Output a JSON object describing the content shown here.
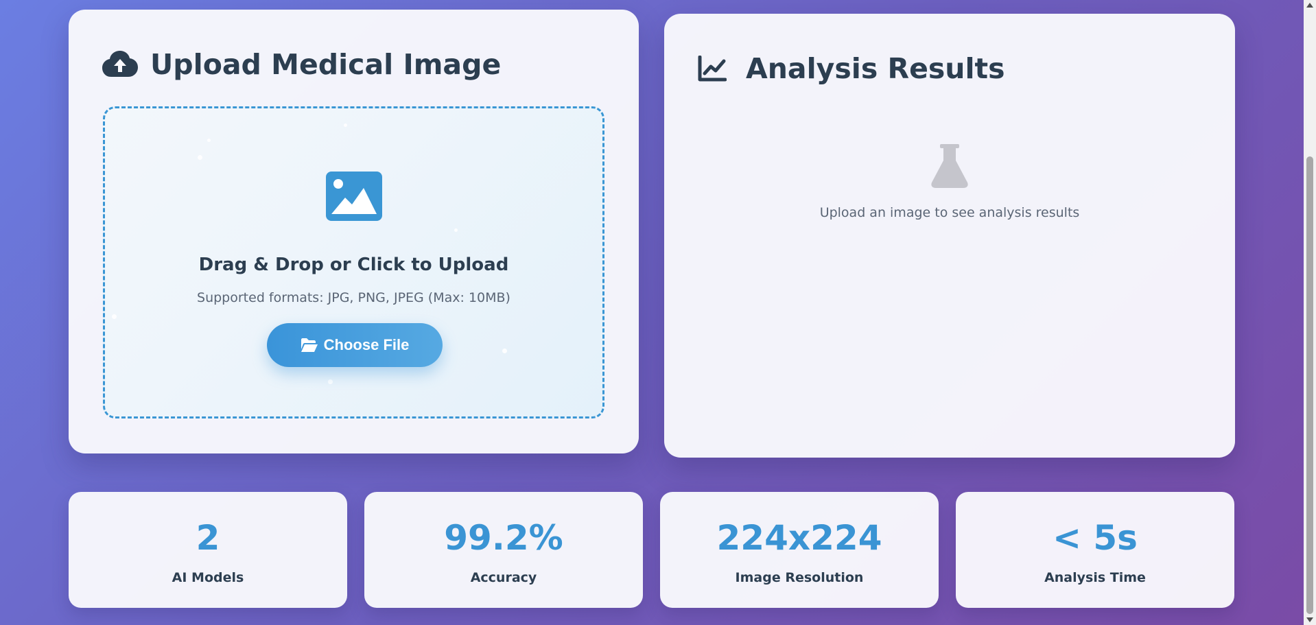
{
  "upload": {
    "title": "Upload Medical Image",
    "title_icon": "cloud-upload-icon",
    "dropzone": {
      "icon": "image-icon",
      "title": "Drag & Drop or Click to Upload",
      "subtitle": "Supported formats: JPG, PNG, JPEG (Max: 10MB)",
      "button_label": "Choose File",
      "button_icon": "folder-open-icon"
    }
  },
  "results": {
    "title": "Analysis Results",
    "title_icon": "chart-line-icon",
    "empty_icon": "flask-icon",
    "empty_text": "Upload an image to see analysis results"
  },
  "stats": [
    {
      "value": "2",
      "label": "AI Models"
    },
    {
      "value": "99.2%",
      "label": "Accuracy"
    },
    {
      "value": "224x224",
      "label": "Image Resolution"
    },
    {
      "value": "< 5s",
      "label": "Analysis Time"
    }
  ],
  "colors": {
    "accent": "#3a94d4",
    "heading": "#2c3e50",
    "muted_icon": "#c5c5cc",
    "bg_gradient_start": "#6b7ee2",
    "bg_gradient_end": "#7a4ba6"
  }
}
